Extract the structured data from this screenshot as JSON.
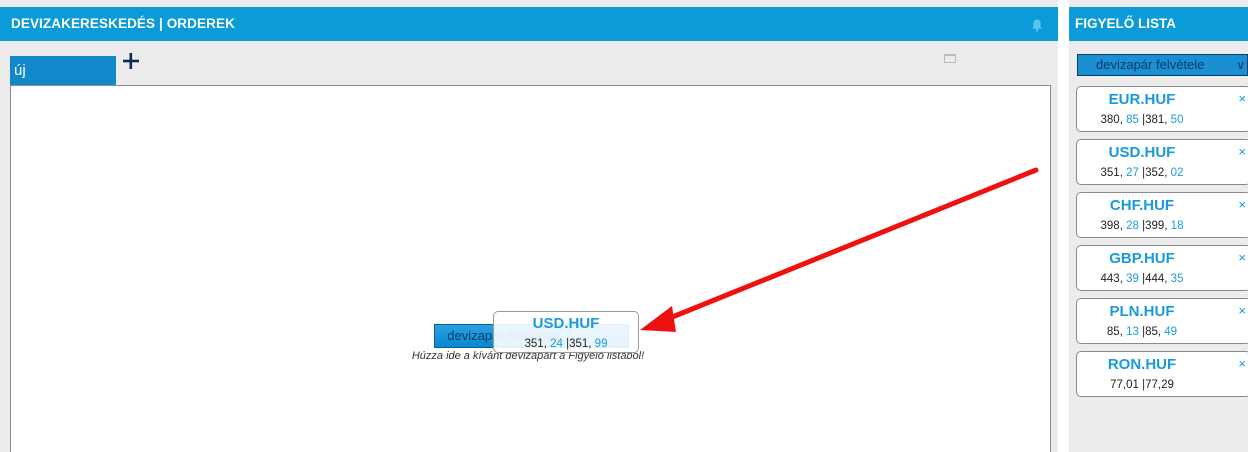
{
  "left_panel": {
    "title": "DEVIZAKERESKEDÉS | ORDEREK",
    "tab_label": "új",
    "add_tab": "+",
    "add_pair_button": "devizapár felvétele",
    "drop_hint": "Húzza ide a kívánt devizapárt a Figyelő listából!"
  },
  "drag_card": {
    "pair": "USD.HUF",
    "bid_int": "351,",
    "bid_dec": " 24",
    "sep": " |",
    "ask_int": "351,",
    "ask_dec": " 99"
  },
  "right_panel": {
    "title": "FIGYELŐ LISTA",
    "select_value": "devizapár felvétele",
    "close_symbol": "×",
    "watch_list": [
      {
        "pair": "EUR.HUF",
        "bid_int": "380,",
        "bid_dec": " 85",
        "sep": " |",
        "ask_int": "381,",
        "ask_dec": " 50"
      },
      {
        "pair": "USD.HUF",
        "bid_int": "351,",
        "bid_dec": " 27",
        "sep": " |",
        "ask_int": "352,",
        "ask_dec": " 02"
      },
      {
        "pair": "CHF.HUF",
        "bid_int": "398,",
        "bid_dec": " 28",
        "sep": " |",
        "ask_int": "399,",
        "ask_dec": " 18"
      },
      {
        "pair": "GBP.HUF",
        "bid_int": "443,",
        "bid_dec": " 39",
        "sep": " |",
        "ask_int": "444,",
        "ask_dec": " 35"
      },
      {
        "pair": "PLN.HUF",
        "bid_int": "85,",
        "bid_dec": " 13",
        "sep": " |",
        "ask_int": "85,",
        "ask_dec": " 49"
      },
      {
        "pair": "RON.HUF",
        "bid_int": "77,01",
        "bid_dec": "",
        "sep": "  |",
        "ask_int": "77,29",
        "ask_dec": ""
      }
    ]
  },
  "colors": {
    "header_bg": "#0a9bd8",
    "accent_blue": "#1a9ad9",
    "annotation_arrow": "#ee1111"
  },
  "icons": [
    "bell-icon",
    "plus-icon",
    "restore-icon",
    "chevron-down-icon",
    "close-icon"
  ]
}
